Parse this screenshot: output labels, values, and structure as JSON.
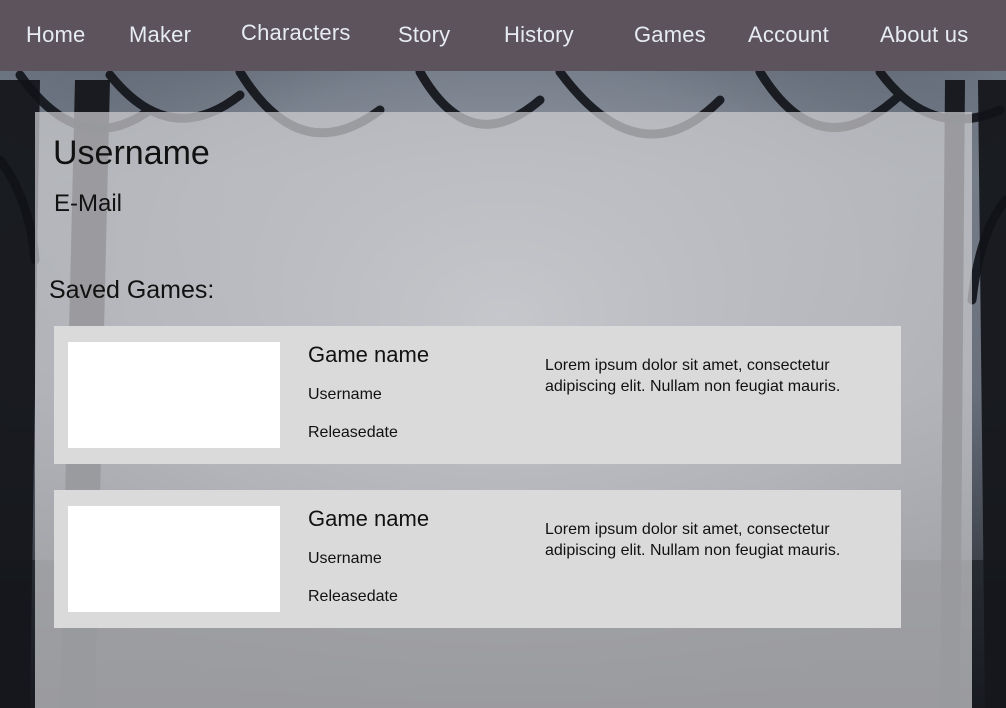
{
  "nav": {
    "items": [
      {
        "label": "Home"
      },
      {
        "label": "Maker"
      },
      {
        "label": "Characters"
      },
      {
        "label": "Story"
      },
      {
        "label": "History"
      },
      {
        "label": "Games"
      },
      {
        "label": "Account"
      },
      {
        "label": "About us"
      }
    ]
  },
  "profile": {
    "username": "Username",
    "email": "E-Mail"
  },
  "saved_games": {
    "heading": "Saved Games:",
    "items": [
      {
        "name": "Game name",
        "username": "Username",
        "releasedate": "Releasedate",
        "description": "Lorem ipsum dolor sit amet, consectetur adipiscing elit. Nullam non feugiat mauris."
      },
      {
        "name": "Game name",
        "username": "Username",
        "releasedate": "Releasedate",
        "description": "Lorem ipsum dolor sit amet, consectetur adipiscing elit. Nullam non feugiat mauris."
      }
    ]
  },
  "colors": {
    "nav_background": "#5d535d",
    "nav_text": "#e6ecf1",
    "card_background": "#dadada",
    "thumbnail": "#ffffff"
  }
}
